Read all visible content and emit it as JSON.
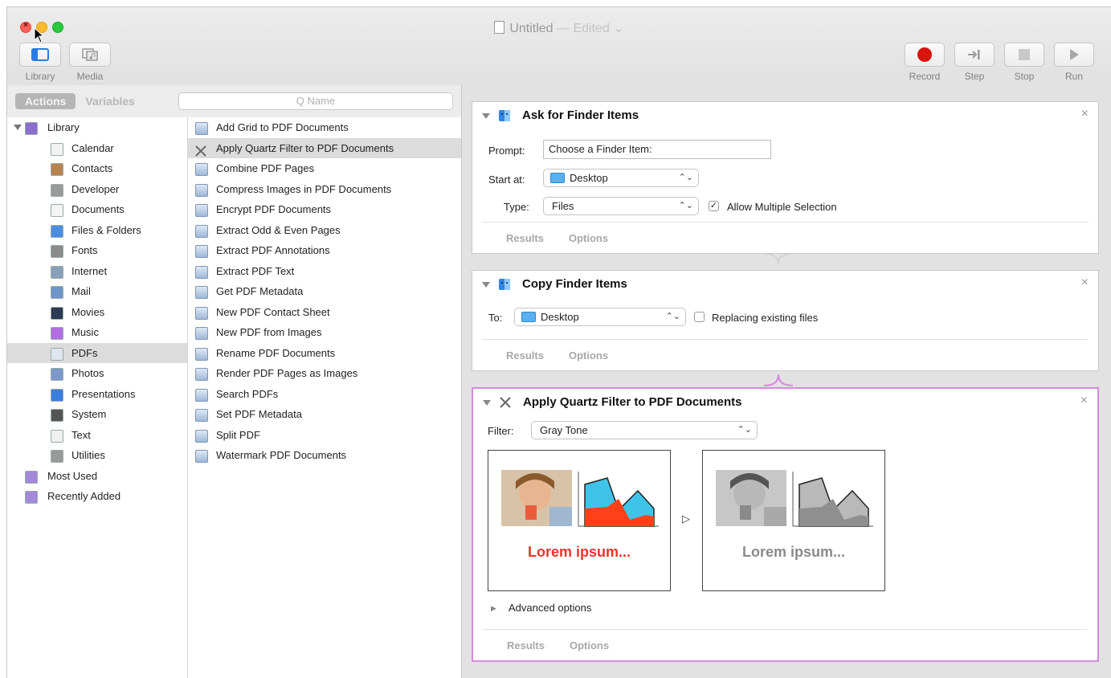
{
  "window": {
    "title": "Untitled",
    "title_suffix": "— Edited ⌄"
  },
  "toolbar": {
    "left": [
      {
        "label": "Library",
        "icon": "library-icon"
      },
      {
        "label": "Media",
        "icon": "media-icon"
      }
    ],
    "right": [
      {
        "label": "Record",
        "icon": "record-icon"
      },
      {
        "label": "Step",
        "icon": "step-icon"
      },
      {
        "label": "Stop",
        "icon": "stop-icon"
      },
      {
        "label": "Run",
        "icon": "run-icon"
      }
    ]
  },
  "left_panel": {
    "tabs": [
      "Actions",
      "Variables"
    ],
    "search_placeholder": "Q Name",
    "library": [
      {
        "label": "Library",
        "top": true,
        "color": "#8a6fd0"
      },
      {
        "label": "Calendar",
        "color": "#f2f2f2"
      },
      {
        "label": "Contacts",
        "color": "#b48350"
      },
      {
        "label": "Developer",
        "color": "#9a9a9a"
      },
      {
        "label": "Documents",
        "color": "#f4f4f4"
      },
      {
        "label": "Files & Folders",
        "color": "#4a8ee0"
      },
      {
        "label": "Fonts",
        "color": "#8a8a8a"
      },
      {
        "label": "Internet",
        "color": "#8aa0b8"
      },
      {
        "label": "Mail",
        "color": "#6f94c8"
      },
      {
        "label": "Movies",
        "color": "#2b3a55"
      },
      {
        "label": "Music",
        "color": "#b06ee0"
      },
      {
        "label": "PDFs",
        "color": "#dfe6f0",
        "selected": true
      },
      {
        "label": "Photos",
        "color": "#7b98c8"
      },
      {
        "label": "Presentations",
        "color": "#3b7de0"
      },
      {
        "label": "System",
        "color": "#555555"
      },
      {
        "label": "Text",
        "color": "#f0f0f0"
      },
      {
        "label": "Utilities",
        "color": "#9a9a9a"
      },
      {
        "label": "Most Used",
        "top": true,
        "color": "#a38ad8"
      },
      {
        "label": "Recently Added",
        "top": true,
        "color": "#a38ad8"
      }
    ],
    "actions": [
      "Add Grid to PDF Documents",
      "Apply Quartz Filter to PDF Documents",
      "Combine PDF Pages",
      "Compress Images in PDF Documents",
      "Encrypt PDF Documents",
      "Extract Odd & Even Pages",
      "Extract PDF Annotations",
      "Extract PDF Text",
      "Get PDF Metadata",
      "New PDF Contact Sheet",
      "New PDF from Images",
      "Rename PDF Documents",
      "Render PDF Pages as Images",
      "Search PDFs",
      "Set PDF Metadata",
      "Split PDF",
      "Watermark PDF Documents"
    ],
    "selected_action": 1
  },
  "workflow": {
    "ask": {
      "title": "Ask for Finder Items",
      "prompt_label": "Prompt:",
      "prompt_value": "Choose a Finder Item:",
      "start_label": "Start at:",
      "start_value": "Desktop",
      "type_label": "Type:",
      "type_value": "Files",
      "allow_multiple": "Allow Multiple Selection",
      "results": "Results",
      "options": "Options"
    },
    "copy": {
      "title": "Copy Finder Items",
      "to_label": "To:",
      "to_value": "Desktop",
      "replacing": "Replacing existing files",
      "results": "Results",
      "options": "Options"
    },
    "quartz": {
      "title": "Apply Quartz Filter to PDF Documents",
      "filter_label": "Filter:",
      "filter_value": "Gray Tone",
      "preview_text_before": "Lorem ipsum...",
      "preview_text_after": "Lorem ipsum...",
      "advanced": "Advanced options",
      "results": "Results",
      "options": "Options"
    },
    "close_glyph": "×"
  },
  "colors": {
    "accent_selection": "#d58bdc",
    "lorem_before": "#e8352b",
    "lorem_after": "#8a8a8a",
    "record": "#d9140d"
  }
}
